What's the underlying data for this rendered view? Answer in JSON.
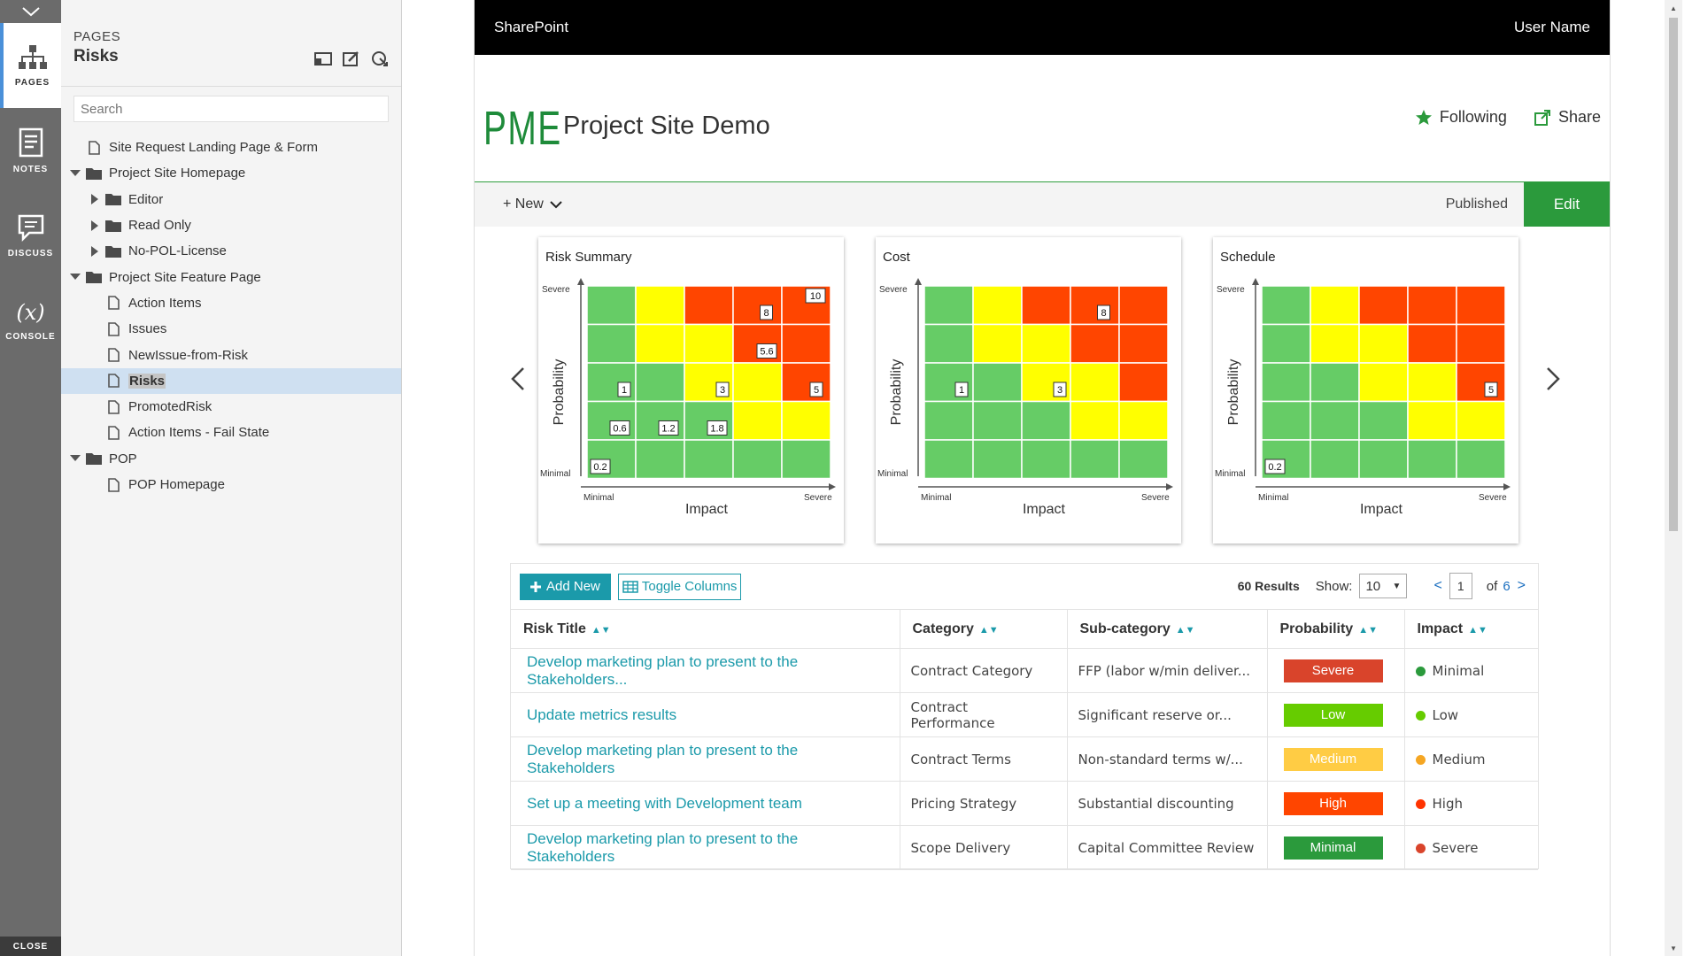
{
  "rail": {
    "items": [
      {
        "label": "PAGES",
        "icon": "sitemap-icon"
      },
      {
        "label": "NOTES",
        "icon": "notes-icon"
      },
      {
        "label": "DISCUSS",
        "icon": "discuss-icon"
      },
      {
        "label": "CONSOLE",
        "icon": "console-icon",
        "glyph": "(x)"
      }
    ],
    "close_label": "CLOSE"
  },
  "panel": {
    "kicker": "PAGES",
    "title": "Risks",
    "search_placeholder": "Search",
    "tree": [
      {
        "label": "Site Request Landing Page & Form",
        "type": "page",
        "depth": 0,
        "expand": ""
      },
      {
        "label": "Project Site Homepage",
        "type": "folder",
        "depth": 0,
        "expand": "open"
      },
      {
        "label": "Editor",
        "type": "folder",
        "depth": 1,
        "expand": "closed"
      },
      {
        "label": "Read Only",
        "type": "folder",
        "depth": 1,
        "expand": "closed"
      },
      {
        "label": "No-POL-License",
        "type": "folder",
        "depth": 1,
        "expand": "closed"
      },
      {
        "label": "Project Site Feature Page",
        "type": "folder",
        "depth": 0,
        "expand": "open"
      },
      {
        "label": "Action Items",
        "type": "page",
        "depth": 1,
        "expand": ""
      },
      {
        "label": "Issues",
        "type": "page",
        "depth": 1,
        "expand": ""
      },
      {
        "label": "NewIssue-from-Risk",
        "type": "page",
        "depth": 1,
        "expand": ""
      },
      {
        "label": "Risks",
        "type": "page",
        "depth": 1,
        "expand": "",
        "selected": true
      },
      {
        "label": "PromotedRisk",
        "type": "page",
        "depth": 1,
        "expand": ""
      },
      {
        "label": "Action Items - Fail State",
        "type": "page",
        "depth": 1,
        "expand": ""
      },
      {
        "label": "POP",
        "type": "folder",
        "depth": 0,
        "expand": "open"
      },
      {
        "label": "POP Homepage",
        "type": "page",
        "depth": 1,
        "expand": ""
      }
    ]
  },
  "topbar": {
    "app": "SharePoint",
    "user": "User Name"
  },
  "site": {
    "logo": "PME",
    "title": "Project Site Demo",
    "following_label": "Following",
    "share_label": "Share"
  },
  "commandbar": {
    "new_label": "+ New",
    "status": "Published",
    "edit_label": "Edit"
  },
  "colors": {
    "accent": "#1b9aaa",
    "brand_green": "#2b9a3c",
    "heat_green": "#66cc66",
    "heat_yellow": "#ffff00",
    "heat_red": "#ff4500"
  },
  "heat_grid": [
    [
      "G",
      "Y",
      "R",
      "R",
      "R"
    ],
    [
      "G",
      "Y",
      "Y",
      "R",
      "R"
    ],
    [
      "G",
      "G",
      "Y",
      "Y",
      "R"
    ],
    [
      "G",
      "G",
      "G",
      "Y",
      "Y"
    ],
    [
      "G",
      "G",
      "G",
      "G",
      "G"
    ]
  ],
  "chart_data": [
    {
      "type": "heatmap",
      "title": "Risk Summary",
      "xlabel": "Impact",
      "ylabel": "Probability",
      "x_ticks": [
        "Minimal",
        "Severe"
      ],
      "y_ticks": [
        "Minimal",
        "Severe"
      ],
      "markers": [
        {
          "label": "10",
          "col": 5,
          "row": 5
        },
        {
          "label": "8",
          "col": 4,
          "row": 5
        },
        {
          "label": "5.6",
          "col": 4,
          "row": 4
        },
        {
          "label": "1",
          "col": 1,
          "row": 3
        },
        {
          "label": "3",
          "col": 3,
          "row": 3
        },
        {
          "label": "5",
          "col": 5,
          "row": 3
        },
        {
          "label": "0.6",
          "col": 1,
          "row": 2
        },
        {
          "label": "1.2",
          "col": 2,
          "row": 2
        },
        {
          "label": "1.8",
          "col": 3,
          "row": 2
        },
        {
          "label": "0.2",
          "col": 1,
          "row": 1
        }
      ]
    },
    {
      "type": "heatmap",
      "title": "Cost",
      "xlabel": "Impact",
      "ylabel": "Probability",
      "x_ticks": [
        "Minimal",
        "Severe"
      ],
      "y_ticks": [
        "Minimal",
        "Severe"
      ],
      "markers": [
        {
          "label": "8",
          "col": 4,
          "row": 5
        },
        {
          "label": "1",
          "col": 1,
          "row": 3
        },
        {
          "label": "3",
          "col": 3,
          "row": 3
        }
      ]
    },
    {
      "type": "heatmap",
      "title": "Schedule",
      "xlabel": "Impact",
      "ylabel": "Probability",
      "x_ticks": [
        "Minimal",
        "Severe"
      ],
      "y_ticks": [
        "Minimal",
        "Severe"
      ],
      "markers": [
        {
          "label": "5",
          "col": 5,
          "row": 3
        },
        {
          "label": "0.2",
          "col": 1,
          "row": 1
        }
      ]
    }
  ],
  "grid": {
    "add_label": "Add New",
    "toggle_label": "Toggle Columns",
    "results": "60 Results",
    "show_label": "Show:",
    "show_value": "10",
    "page": "1",
    "of_label": "of",
    "total_pages": "6",
    "prev": "<",
    "next": ">",
    "columns": [
      "Risk Title",
      "Category",
      "Sub-category",
      "Probability",
      "Impact"
    ],
    "rows": [
      {
        "title": "Develop marketing plan to present to the Stakeholders...",
        "category": "Contract Category",
        "subcategory": "FFP (labor w/min deliver...",
        "probability": "Severe",
        "prob_color": "#d9442b",
        "impact": "Minimal",
        "impact_color": "#2b9a3c"
      },
      {
        "title": "Update metrics results",
        "category": "Contract Performance",
        "subcategory": "Significant reserve or...",
        "probability": "Low",
        "prob_color": "#66cc00",
        "impact": "Low",
        "impact_color": "#66cc00"
      },
      {
        "title": "Develop marketing plan to present to the Stakeholders",
        "category": "Contract Terms",
        "subcategory": "Non-standard terms w/...",
        "probability": "Medium",
        "prob_color": "#ffcc44",
        "impact": "Medium",
        "impact_color": "#f5a623"
      },
      {
        "title": "Set up a meeting with Development team",
        "category": "Pricing Strategy",
        "subcategory": "Substantial discounting",
        "probability": "High",
        "prob_color": "#ff4500",
        "impact": "High",
        "impact_color": "#ff3300"
      },
      {
        "title": "Develop marketing plan to present to the Stakeholders",
        "category": "Scope Delivery",
        "subcategory": "Capital Committee Review",
        "probability": "Minimal",
        "prob_color": "#2b9a3c",
        "impact": "Severe",
        "impact_color": "#d9442b"
      }
    ]
  }
}
